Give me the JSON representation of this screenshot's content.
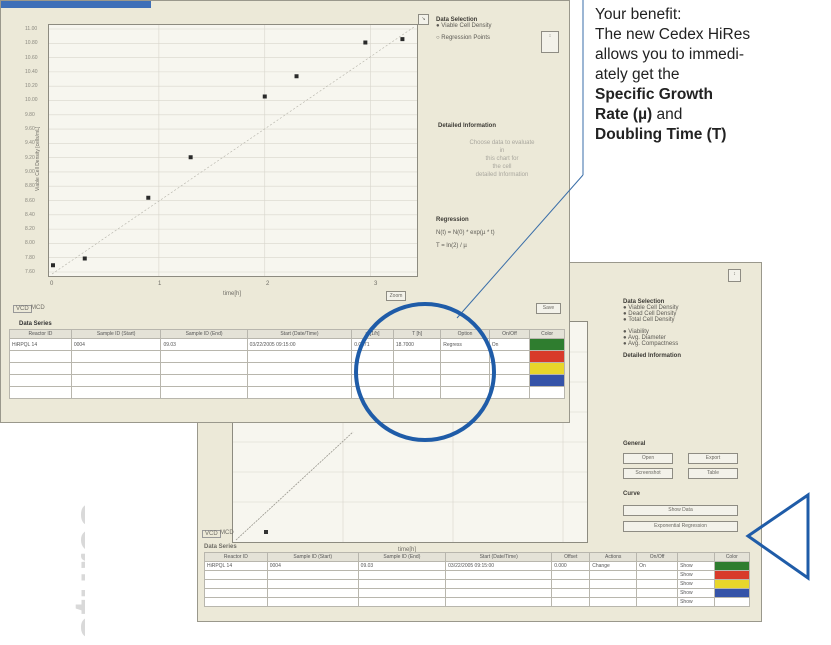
{
  "benefit": {
    "line1": "Your benefit:",
    "line2": "The new Cedex HiRes",
    "line3": "allows you to immedi-",
    "line4": "ately get the",
    "bold1": "Specific Growth",
    "bold2": "Rate (µ)",
    "and": " and",
    "bold3": "Doubling Time (T)"
  },
  "side_word": "atures",
  "front_window": {
    "data_selection": {
      "title": "Data Selection",
      "options": [
        "Viable Cell Density",
        "Regression Points"
      ]
    },
    "detailed_info": {
      "title": "Detailed Information",
      "lines": [
        "Choose data to evaluate",
        "in",
        "this chart for",
        "the cell",
        "detailed Information"
      ]
    },
    "regression": {
      "title": "Regression",
      "formula1": "N(t) = N(0) * exp(µ * t)",
      "formula2": "T = ln(2) / µ"
    },
    "xlabel": "time[h]",
    "ylabel": "Viable Cell Density [cells/mL]",
    "ytick_labels": [
      "11.00",
      "10.80",
      "10.60",
      "10.40",
      "10.20",
      "10.00",
      "9.80",
      "9.60",
      "9.40",
      "9.20",
      "9.00",
      "8.80",
      "8.60",
      "8.40",
      "8.20",
      "8.00",
      "7.80",
      "7.60"
    ],
    "xtick_labels": [
      "0",
      "1",
      "2",
      "3"
    ],
    "tabs": [
      "VCD",
      "MCD"
    ],
    "save_label": "Save",
    "zoom_label": "Zoom",
    "data_series": {
      "title": "Data Series",
      "headers": [
        "Reactor ID",
        "Sample ID (Start)",
        "Sample ID (End)",
        "Start (Date/Time)",
        "µ [1/h]",
        "T [h]",
        "Option",
        "On/Off",
        "Color"
      ],
      "row1": [
        "HiRPQL 14",
        "0004",
        "09.03",
        "03/22/2005 09:15:00",
        "0.0371",
        "18.7000",
        "Regress",
        "On",
        ""
      ]
    },
    "colors": [
      "#2f7d2f",
      "#d83a2a",
      "#e8d62b",
      "#3553a8",
      "#ffffff"
    ]
  },
  "back_window": {
    "data_selection": {
      "title": "Data Selection",
      "options": [
        "Viable Cell Density",
        "Dead Cell Density",
        "Total Cell Density"
      ],
      "options2": [
        "Viability",
        "Avg. Diameter",
        "Avg. Compactness"
      ]
    },
    "detailed_info_title": "Detailed Information",
    "general": {
      "title": "General",
      "open": "Open",
      "export": "Export",
      "screenshot": "Screenshot",
      "table": "Table"
    },
    "curve": {
      "title": "Curve",
      "btn1": "Show Data",
      "btn2": "Exponential Regression"
    },
    "xlabel": "time[h]",
    "tabs": [
      "VCD",
      "MCD"
    ],
    "data_series": {
      "title": "Data Series",
      "headers": [
        "Reactor ID",
        "Sample ID (Start)",
        "Sample ID (End)",
        "Start (Date/Time)",
        "Offset",
        "Actions",
        "On/Off",
        "Color"
      ],
      "row1": [
        "HiRPQL 14",
        "0004",
        "09.03",
        "03/22/2005 09:15:00",
        "0.000",
        "Change",
        "On",
        "Show"
      ]
    },
    "show_label": "Show",
    "colors": [
      "#2f7d2f",
      "#d83a2a",
      "#e8d62b",
      "#3553a8",
      "#ffffff"
    ]
  },
  "chart_data": {
    "type": "scatter",
    "x": [
      0.0,
      0.3,
      0.9,
      1.3,
      2.0,
      2.3,
      2.95,
      3.3
    ],
    "y": [
      7.6,
      7.7,
      8.6,
      9.2,
      10.1,
      10.4,
      10.9,
      10.95
    ],
    "xlim": [
      0,
      3.4
    ],
    "ylim": [
      7.5,
      11.1
    ]
  }
}
